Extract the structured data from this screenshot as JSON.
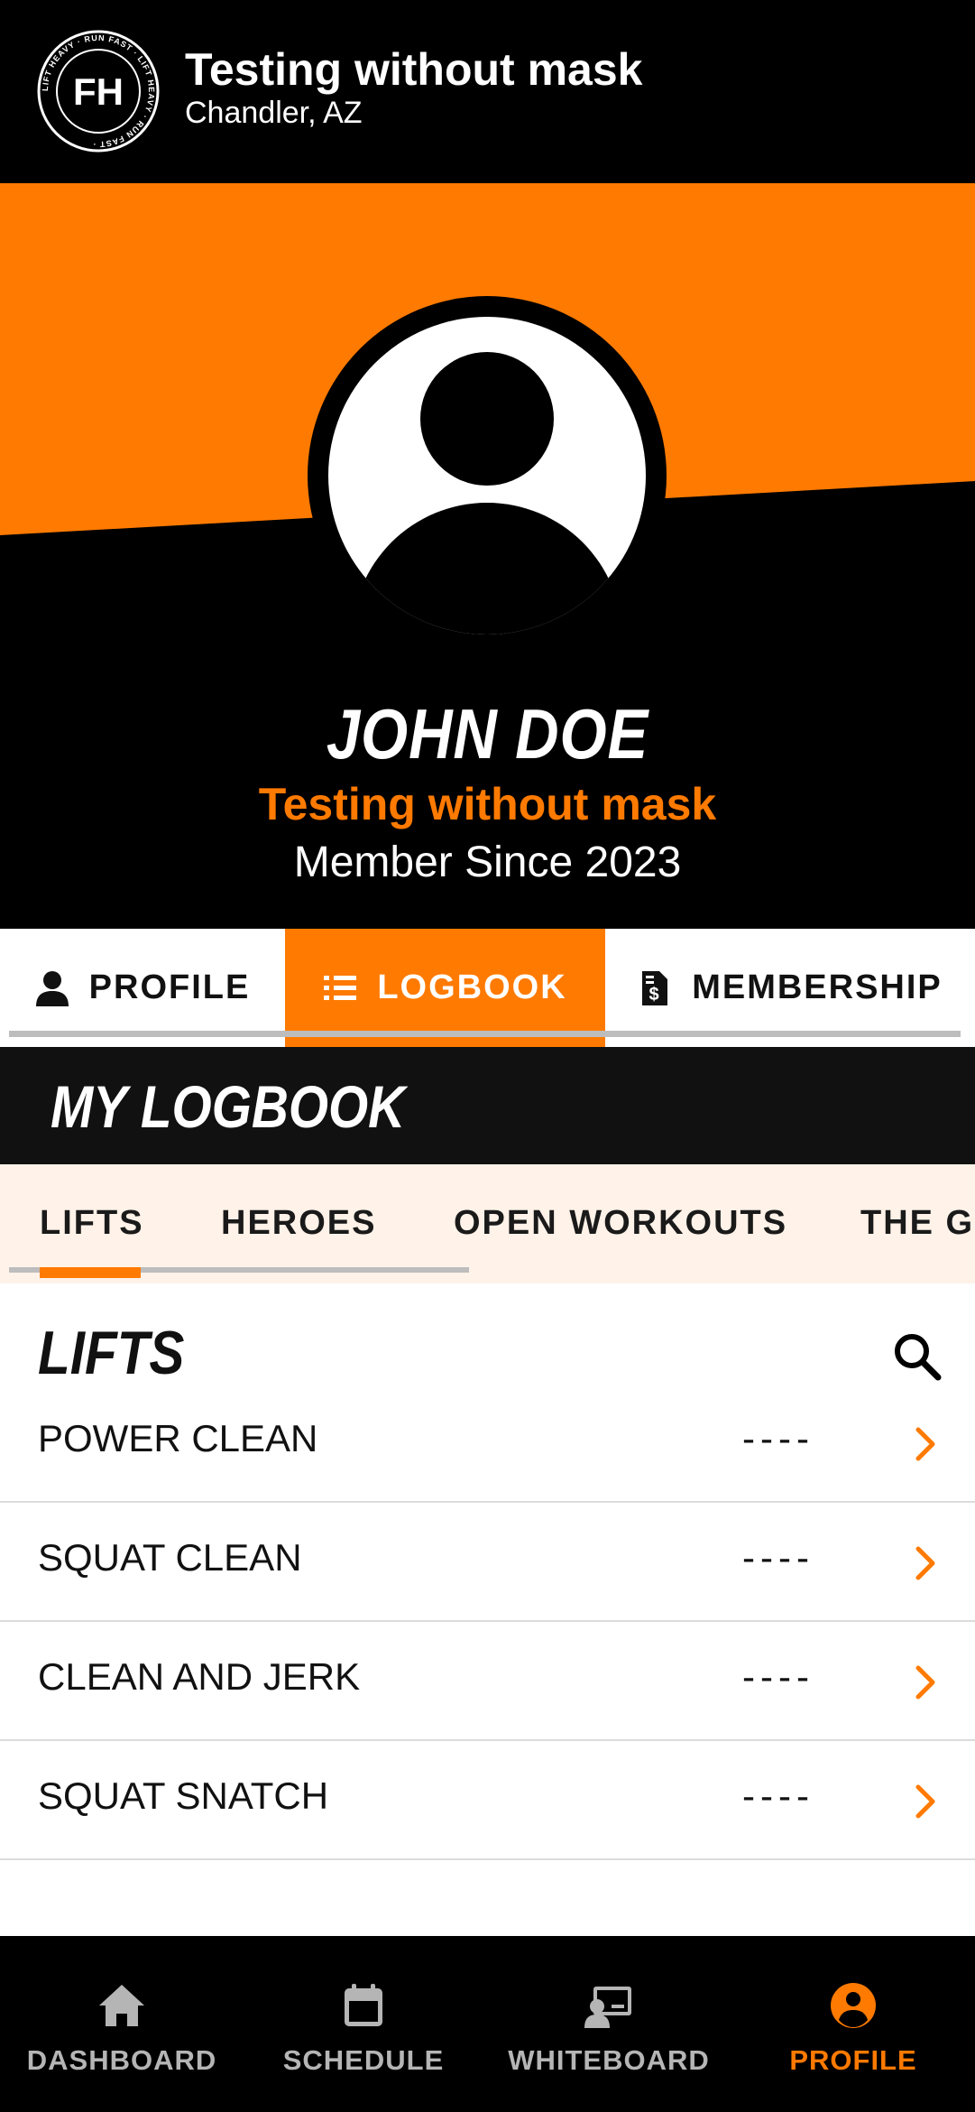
{
  "header": {
    "title": "Testing without mask",
    "subtitle": "Chandler, AZ",
    "logo": {
      "monogram": "FH",
      "ring_text": "LIFT HEAVY · RUN FAST · LIFT HEAVY · RUN FAST ·"
    }
  },
  "profile": {
    "name": "JOHN DOE",
    "org": "Testing without mask",
    "member_since": "Member Since 2023"
  },
  "main_tabs": [
    {
      "label": "PROFILE",
      "icon": "person-icon",
      "active": false
    },
    {
      "label": "LOGBOOK",
      "icon": "list-icon",
      "active": true
    },
    {
      "label": "MEMBERSHIP",
      "icon": "invoice-icon",
      "active": false
    }
  ],
  "logbook": {
    "title": "MY LOGBOOK",
    "sub_tabs": [
      {
        "label": "LIFTS",
        "active": true
      },
      {
        "label": "HEROES",
        "active": false
      },
      {
        "label": "OPEN WORKOUTS",
        "active": false
      },
      {
        "label": "THE GI",
        "active": false
      }
    ],
    "section_title": "LIFTS",
    "items": [
      {
        "name": "POWER CLEAN",
        "value": "----"
      },
      {
        "name": "SQUAT CLEAN",
        "value": "----"
      },
      {
        "name": "CLEAN AND JERK",
        "value": "----"
      },
      {
        "name": "SQUAT SNATCH",
        "value": "----"
      }
    ]
  },
  "bottom_nav": [
    {
      "label": "DASHBOARD",
      "icon": "home-icon",
      "active": false
    },
    {
      "label": "SCHEDULE",
      "icon": "calendar-icon",
      "active": false
    },
    {
      "label": "WHITEBOARD",
      "icon": "whiteboard-icon",
      "active": false
    },
    {
      "label": "PROFILE",
      "icon": "profile-icon",
      "active": true
    }
  ],
  "colors": {
    "accent": "#ff7a00",
    "dark": "#000000",
    "banner": "#111111",
    "subtab_bg": "#fff2e8",
    "inactive_nav": "#b5b5b5"
  }
}
